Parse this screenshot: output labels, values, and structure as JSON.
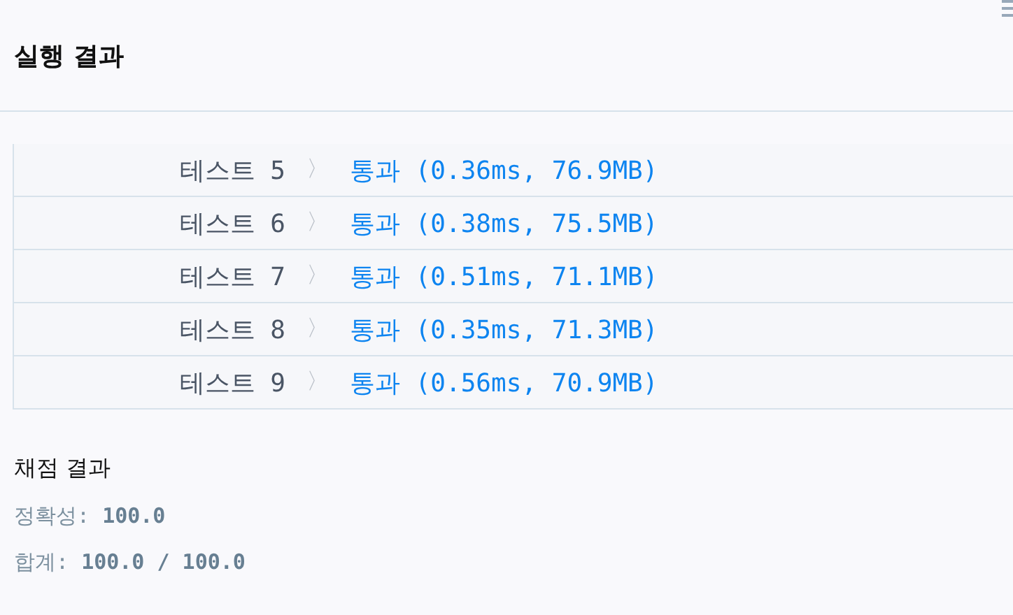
{
  "header": {
    "title": "실행 결과"
  },
  "tests": [
    {
      "label": "테스트 5",
      "chevron": "〉",
      "result": "통과 (0.36ms, 76.9MB)"
    },
    {
      "label": "테스트 6",
      "chevron": "〉",
      "result": "통과 (0.38ms, 75.5MB)"
    },
    {
      "label": "테스트 7",
      "chevron": "〉",
      "result": "통과 (0.51ms, 71.1MB)"
    },
    {
      "label": "테스트 8",
      "chevron": "〉",
      "result": "통과 (0.35ms, 71.3MB)"
    },
    {
      "label": "테스트 9",
      "chevron": "〉",
      "result": "통과 (0.56ms, 70.9MB)"
    }
  ],
  "grading": {
    "title": "채점 결과",
    "lines": [
      "정확성: **100.0**",
      "합계: **100.0 / 100.0**"
    ]
  }
}
